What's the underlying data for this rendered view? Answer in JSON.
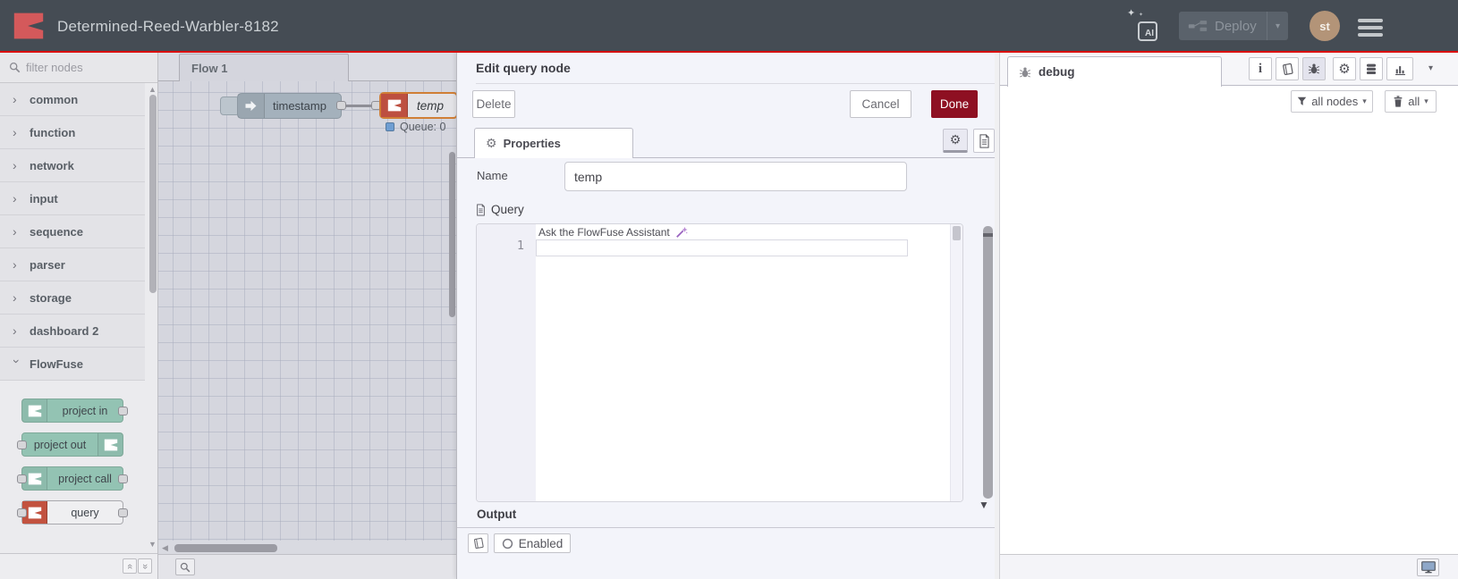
{
  "header": {
    "title": "Determined-Reed-Warbler-8182",
    "ai_label": "AI",
    "deploy_label": "Deploy",
    "avatar": "st"
  },
  "palette": {
    "search_placeholder": "filter nodes",
    "categories": [
      {
        "label": "common"
      },
      {
        "label": "function"
      },
      {
        "label": "network"
      },
      {
        "label": "input"
      },
      {
        "label": "sequence"
      },
      {
        "label": "parser"
      },
      {
        "label": "storage"
      },
      {
        "label": "dashboard 2"
      },
      {
        "label": "FlowFuse"
      }
    ],
    "nodes": [
      {
        "label": "project in"
      },
      {
        "label": "project out"
      },
      {
        "label": "project call"
      },
      {
        "label": "query"
      }
    ]
  },
  "canvas": {
    "tab": "Flow 1",
    "inject_node": "timestamp",
    "query_node": "temp",
    "status": "Queue: 0"
  },
  "tray": {
    "title": "Edit query node",
    "delete": "Delete",
    "cancel": "Cancel",
    "done": "Done",
    "tab": "Properties",
    "name_label": "Name",
    "name_value": "temp",
    "query_label": "Query",
    "line_number": "1",
    "assistant": "Ask the FlowFuse Assistant",
    "output_label": "Output",
    "enabled": "Enabled"
  },
  "sidebar": {
    "tab": "debug",
    "filter": "all nodes",
    "clear": "all"
  },
  "icons": {
    "chevron": "›",
    "caret_down": "▾",
    "scroll_up": "▲",
    "scroll_down": "▼",
    "scroll_left": "◀",
    "collapse_all": "«",
    "expand_all": "»",
    "gear": "⚙",
    "sparkle": "✦",
    "info": "i"
  },
  "colors": {
    "accent_red": "#dc1010",
    "done_red": "#8e1022",
    "node_teal": "#93c3b3",
    "query_red": "#c2523f",
    "inject_gray": "#a4b1bc",
    "status_blue": "#6f9ed2",
    "selected_orange": "#d07f36"
  }
}
